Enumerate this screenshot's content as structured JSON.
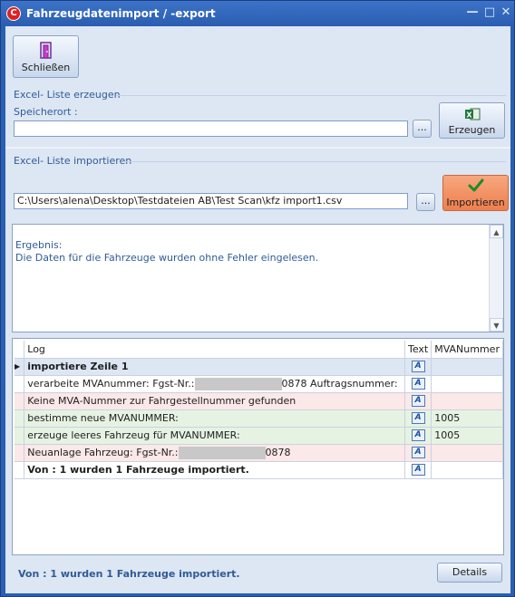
{
  "window": {
    "title": "Fahrzeugdatenimport / -export",
    "app_icon_glyph": "C"
  },
  "toolbar": {
    "close_label": "Schließen",
    "close_icon": "door-exit-icon"
  },
  "export_group": {
    "title": "Excel- Liste erzeugen",
    "storage_label": "Speicherort :",
    "storage_value": "",
    "browse_label": "...",
    "create_label": "Erzeugen",
    "create_icon": "excel-icon"
  },
  "import_group": {
    "title": "Excel- Liste importieren",
    "file_value": "C:\\Users\\alena\\Desktop\\Testdateien AB\\Test Scan\\kfz import1.csv",
    "browse_label": "...",
    "import_label": "Importieren",
    "import_icon": "checkmark-icon",
    "import_color": "#f28a5a"
  },
  "result": {
    "heading": "Ergebnis:",
    "message": "Die Daten für die Fahrzeuge wurden ohne Fehler eingelesen."
  },
  "log_table": {
    "headers": {
      "log": "Log",
      "text": "Text",
      "mva": "MVANummer"
    },
    "rows": [
      {
        "log": "importiere Zeile 1",
        "mva": ""
      },
      {
        "log_prefix": "verarbeite MVAnummer:  Fgst-Nr.:",
        "log_suffix": "0878 Auftragsnummer:",
        "mva": ""
      },
      {
        "log": "Keine MVA-Nummer zur Fahrgestellnummer gefunden",
        "mva": ""
      },
      {
        "log": "bestimme neue MVANUMMER:",
        "mva": "1005"
      },
      {
        "log": "erzeuge leeres Fahrzeug für MVANUMMER:",
        "mva": "1005"
      },
      {
        "log_prefix": "Neuanlage Fahrzeug:  Fgst-Nr.:",
        "log_suffix": "0878",
        "mva": ""
      },
      {
        "log": "Von : 1 wurden 1 Fahrzeuge importiert.",
        "mva": ""
      }
    ]
  },
  "status": {
    "message": "Von : 1 wurden 1 Fahrzeuge importiert."
  },
  "footer": {
    "details_label": "Details"
  }
}
